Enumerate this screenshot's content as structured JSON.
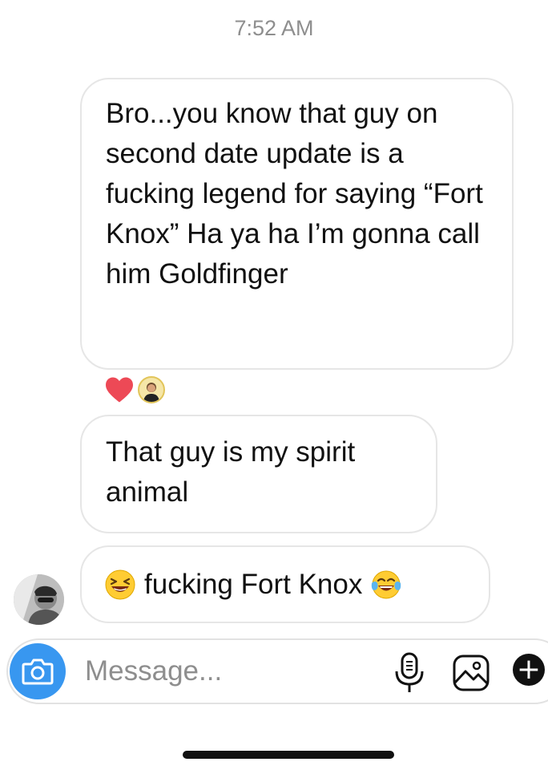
{
  "conversation": {
    "timestamp": "7:52 AM",
    "messages": [
      {
        "text": "Bro...you know that guy on second date update is a fucking legend for saying “Fort Knox” Ha ya ha I’m gonna call him Goldfinger"
      },
      {
        "text": "That guy is my spirit animal"
      },
      {
        "text": "fucking Fort Knox",
        "leading_emoji": "laughing-face",
        "trailing_emoji": "tears-of-joy-face"
      }
    ],
    "reactions": [
      {
        "icon": "heart-icon",
        "color": "#ed4956"
      },
      {
        "icon": "reactor-avatar"
      }
    ]
  },
  "composer": {
    "placeholder": "Message...",
    "camera_icon": "camera-icon",
    "mic_icon": "microphone-icon",
    "gallery_icon": "image-icon",
    "plus_icon": "plus-icon",
    "plus_label": "+"
  },
  "theme": {
    "accent": "#3897f0",
    "bubble_border": "#e6e6e6",
    "muted_text": "#8e8e8e",
    "heart": "#ed4956"
  }
}
